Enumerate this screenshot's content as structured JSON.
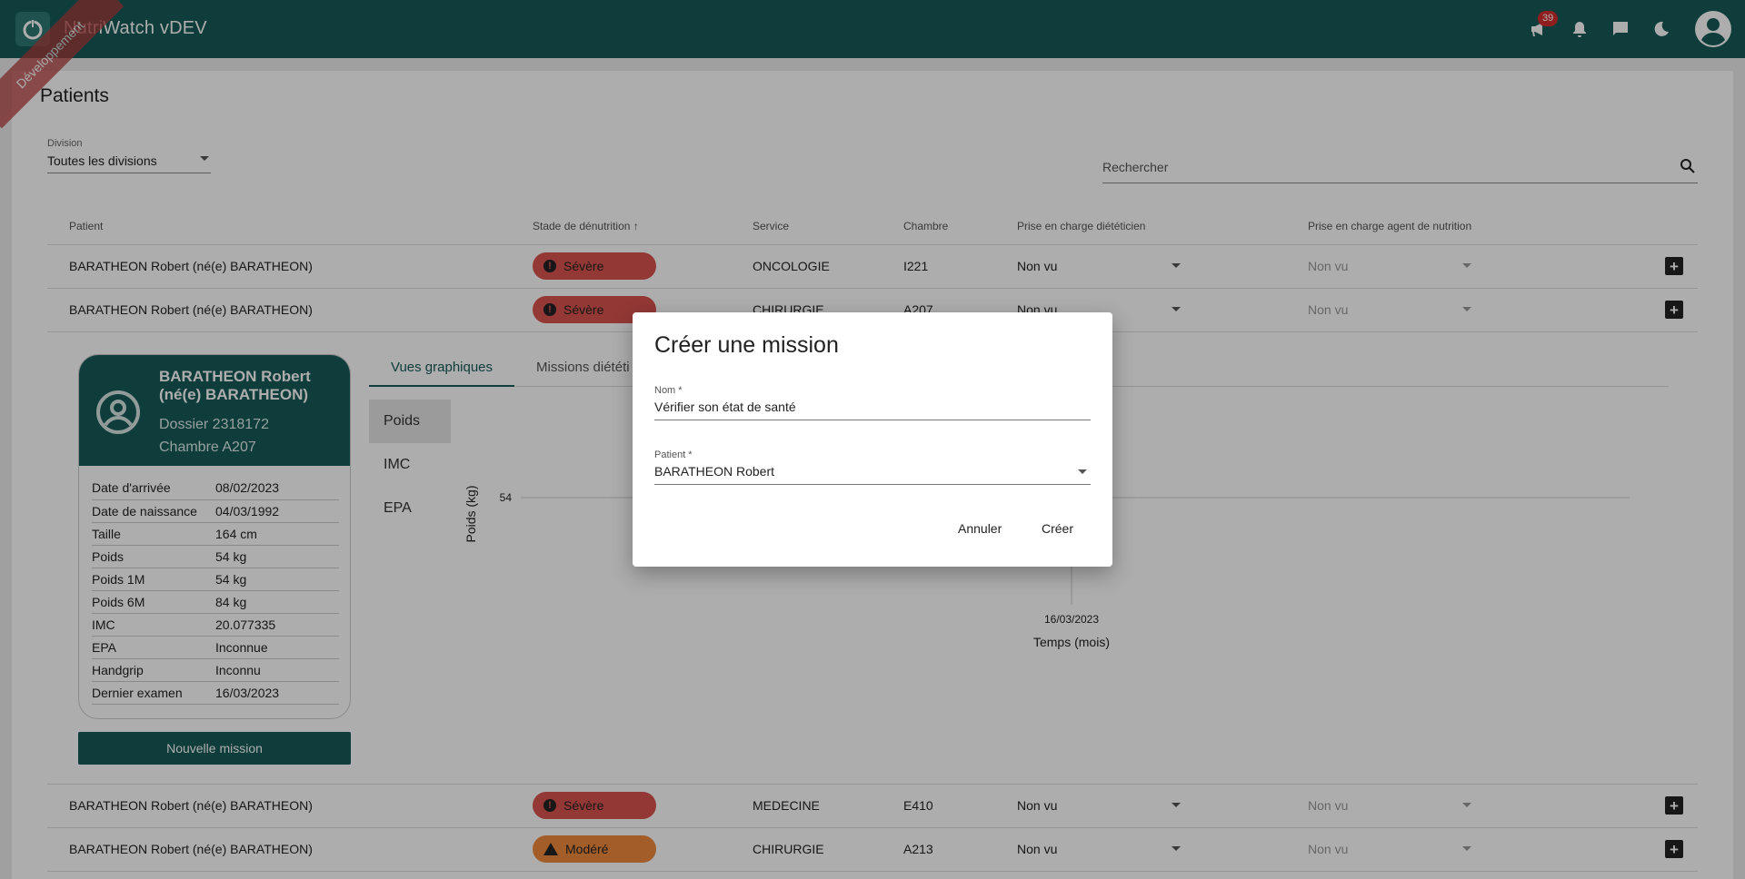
{
  "app": {
    "title": "NutriWatch vDEV",
    "env_ribbon": "Développement",
    "announcement_count": "39"
  },
  "page": {
    "title": "Patients"
  },
  "filters": {
    "division_label": "Division",
    "division_value": "Toutes les divisions",
    "search_placeholder": "Rechercher"
  },
  "table": {
    "headers": [
      "Patient",
      "Stade de dénutrition",
      "Service",
      "Chambre",
      "Prise en charge diététicien",
      "Prise en charge agent de nutrition"
    ],
    "rows": [
      {
        "patient": "BARATHEON Robert (né(e) BARATHEON)",
        "stade": "Sévère",
        "service": "ONCOLOGIE",
        "chambre": "I221",
        "dieteticien": "Non vu",
        "agent": "Non vu"
      },
      {
        "patient": "BARATHEON Robert (né(e) BARATHEON)",
        "stade": "Sévère",
        "service": "CHIRURGIE",
        "chambre": "A207",
        "dieteticien": "Non vu",
        "agent": "Non vu"
      },
      {
        "patient": "BARATHEON Robert (né(e) BARATHEON)",
        "stade": "Sévère",
        "service": "MEDECINE",
        "chambre": "E410",
        "dieteticien": "Non vu",
        "agent": "Non vu"
      },
      {
        "patient": "BARATHEON Robert (né(e) BARATHEON)",
        "stade": "Modéré",
        "service": "CHIRURGIE",
        "chambre": "A213",
        "dieteticien": "Non vu",
        "agent": "Non vu"
      }
    ]
  },
  "card": {
    "name": "BARATHEON Robert (né(e) BARATHEON)",
    "dossier": "Dossier 2318172",
    "chambre": "Chambre A207",
    "details": [
      {
        "k": "Date d'arrivée",
        "v": "08/02/2023"
      },
      {
        "k": "Date de naissance",
        "v": "04/03/1992"
      },
      {
        "k": "Taille",
        "v": "164 cm"
      },
      {
        "k": "Poids",
        "v": "54 kg"
      },
      {
        "k": "Poids 1M",
        "v": "54 kg"
      },
      {
        "k": "Poids 6M",
        "v": "84 kg"
      },
      {
        "k": "IMC",
        "v": "20.077335"
      },
      {
        "k": "EPA",
        "v": "Inconnue"
      },
      {
        "k": "Handgrip",
        "v": "Inconnu"
      },
      {
        "k": "Dernier examen",
        "v": "16/03/2023"
      }
    ],
    "new_mission": "Nouvelle mission"
  },
  "tabs": [
    "Vues graphiques",
    "Missions diététi"
  ],
  "side_tabs": [
    "Poids",
    "IMC",
    "EPA"
  ],
  "chart_data": {
    "type": "scatter",
    "ylabel": "Poids (kg)",
    "xlabel": "Temps (mois)",
    "y_ticks": [
      54
    ],
    "x_ticks": [
      "16/03/2023"
    ]
  },
  "dialog": {
    "title": "Créer une mission",
    "name_label": "Nom *",
    "name_value": "Vérifier son état de santé",
    "patient_label": "Patient *",
    "patient_value": "BARATHEON Robert",
    "cancel": "Annuler",
    "create": "Créer"
  }
}
